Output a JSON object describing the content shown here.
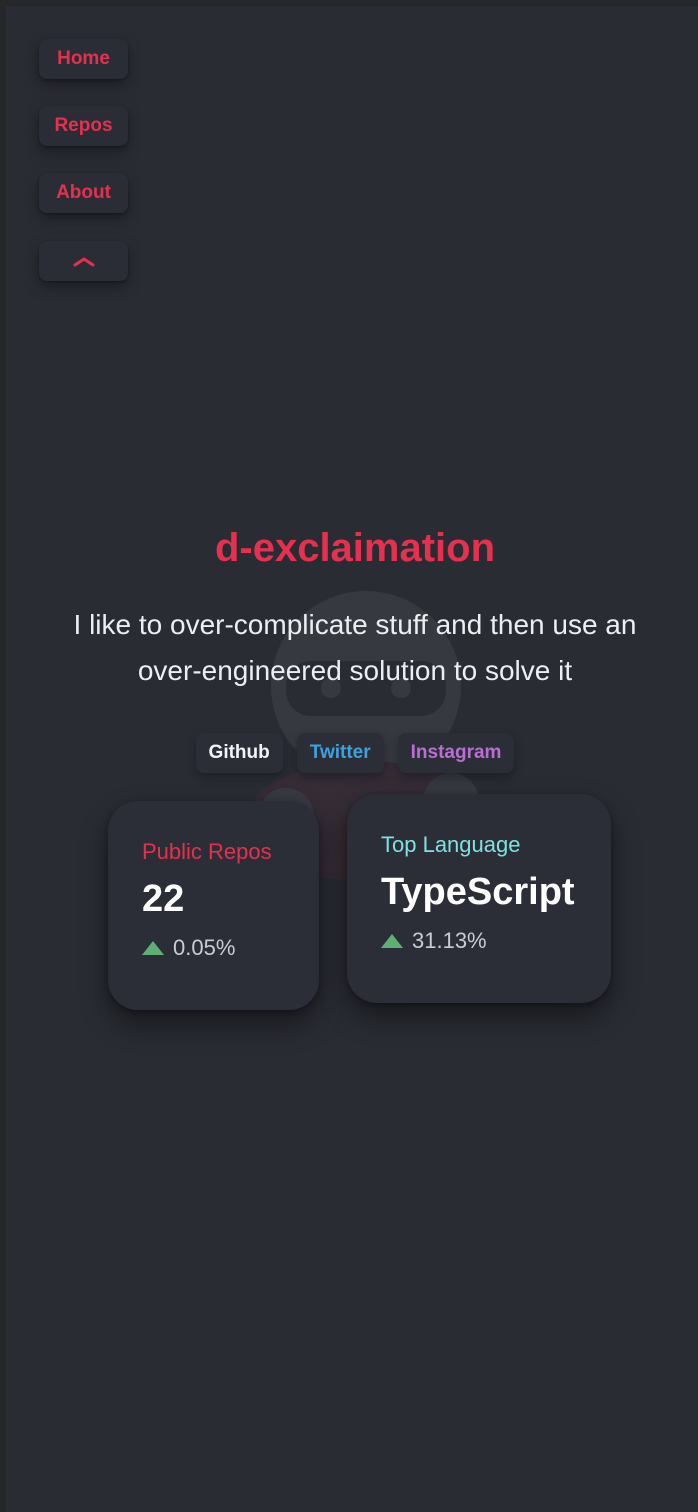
{
  "nav": {
    "items": [
      {
        "label": "Home"
      },
      {
        "label": "Repos"
      },
      {
        "label": "About"
      }
    ],
    "collapse_icon": "chevron-up-icon"
  },
  "hero": {
    "title": "d-exclaimation",
    "subtitle_line1": "I like to over-complicate stuff and then use an",
    "subtitle_line2": "over-engineered solution to solve it"
  },
  "socials": [
    {
      "label": "Github",
      "color": "#f2f3f5"
    },
    {
      "label": "Twitter",
      "color": "#3ea1de"
    },
    {
      "label": "Instagram",
      "color": "#b86fd1"
    }
  ],
  "stats": {
    "repos": {
      "label": "Public Repos",
      "value": "22",
      "change": "0.05%",
      "trend_icon": "triangle-up-icon"
    },
    "language": {
      "label": "Top Language",
      "value": "TypeScript",
      "change": "31.13%",
      "trend_icon": "triangle-up-icon"
    }
  },
  "colors": {
    "accent": "#e5304f",
    "background": "#2a2c34",
    "positive": "#5faf73"
  }
}
